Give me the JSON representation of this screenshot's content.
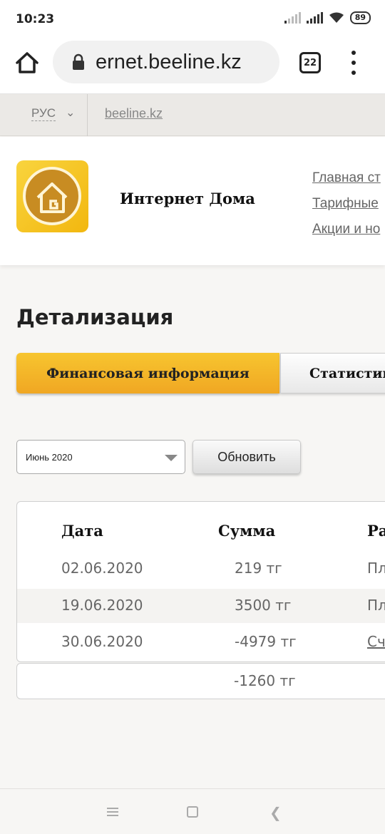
{
  "status_bar": {
    "time": "10:23",
    "battery": "89"
  },
  "browser": {
    "url": "ernet.beeline.kz",
    "tab_count": "22"
  },
  "site_topbar": {
    "language": "РУС",
    "home_link": "beeline.kz"
  },
  "header": {
    "title": "Интернет Дома",
    "nav": [
      "Главная ст",
      "Тарифные",
      "Акции и но"
    ]
  },
  "page": {
    "title": "Детализация",
    "tabs": [
      {
        "label": "Финансовая информация",
        "active": true
      },
      {
        "label": "Статистик",
        "active": false
      }
    ],
    "month_select": {
      "value": "Июнь 2020"
    },
    "refresh_label": "Обновить"
  },
  "table": {
    "headers": [
      "Дата",
      "Сумма",
      "Ра"
    ],
    "rows": [
      {
        "date": "02.06.2020",
        "amount": "219 тг",
        "type": "Пл"
      },
      {
        "date": "19.06.2020",
        "amount": "3500 тг",
        "type": "Пл"
      },
      {
        "date": "30.06.2020",
        "amount": "-4979 тг",
        "type": "Сч"
      }
    ],
    "total": "-1260 тг"
  },
  "colors": {
    "accent": "#f5b92a",
    "header_bg": "#ffffff",
    "page_bg": "#f7f6f4"
  }
}
